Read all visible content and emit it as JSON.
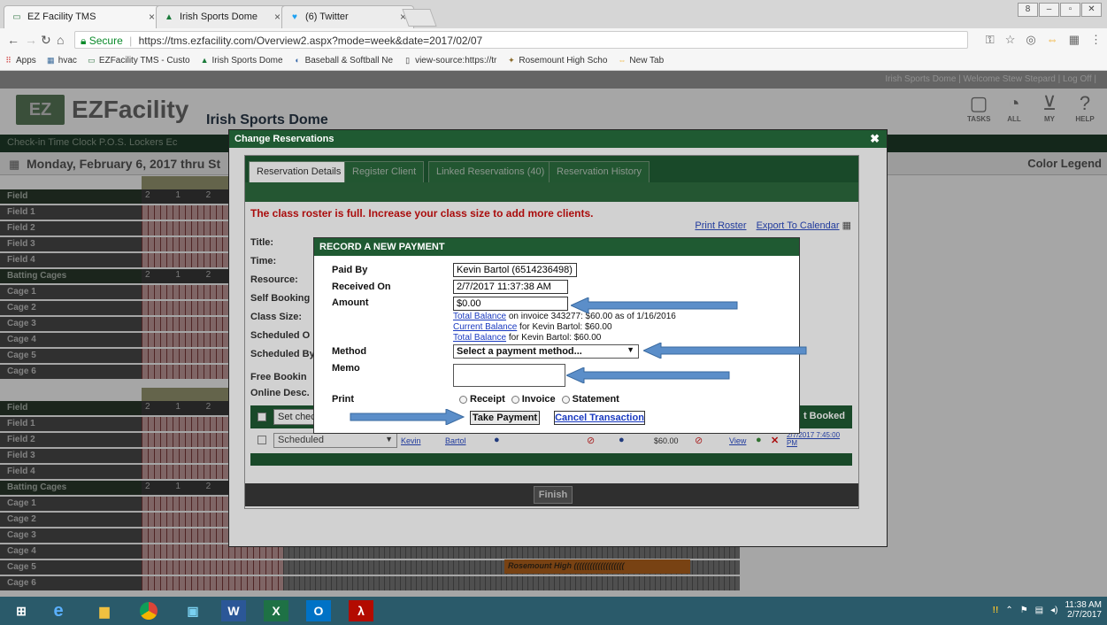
{
  "browser": {
    "tabs": [
      {
        "label": "EZ Facility TMS",
        "icon": "ezfacility-icon"
      },
      {
        "label": "Irish Sports Dome",
        "icon": "irish-icon"
      },
      {
        "label": "(6) Twitter",
        "icon": "twitter-icon"
      }
    ],
    "secure_label": "Secure",
    "url": "https://tms.ezfacility.com/Overview2.aspx?mode=week&date=2017/02/07",
    "bookmarks": [
      {
        "label": "Apps"
      },
      {
        "label": "hvac"
      },
      {
        "label": "EZFacility TMS - Custo"
      },
      {
        "label": "Irish Sports Dome"
      },
      {
        "label": "Baseball & Softball Ne"
      },
      {
        "label": "view-source:https://tr"
      },
      {
        "label": "Rosemount High Scho"
      },
      {
        "label": "New Tab"
      }
    ]
  },
  "page": {
    "top_links": "Irish Sports Dome   |   Welcome Stew Stepard   |   Log Off   |",
    "logo_text": "EZFacility",
    "facility_name": "Irish Sports Dome",
    "top_icons": [
      {
        "label": "TASKS",
        "icon": "clipboard-icon"
      },
      {
        "label": "ALL",
        "icon": "globe-icon"
      },
      {
        "label": "MY",
        "icon": "basket-icon"
      },
      {
        "label": "HELP",
        "icon": "help-icon"
      }
    ],
    "nav": "Check-in  Time Clock  P.O.S.  Lockers  Ec",
    "date_range": "Monday, February 6, 2017 thru St",
    "color_legend": "Color Legend",
    "rows_block1": [
      {
        "label": "Field",
        "header": true,
        "cells": "2 1 2 3"
      },
      {
        "label": "Field 1"
      },
      {
        "label": "Field 2"
      },
      {
        "label": "Field 3"
      },
      {
        "label": "Field 4"
      },
      {
        "label": "Batting Cages",
        "header": true,
        "cells": "2 1 2 3"
      },
      {
        "label": "Cage 1"
      },
      {
        "label": "Cage 2"
      },
      {
        "label": "Cage 3"
      },
      {
        "label": "Cage 4"
      },
      {
        "label": "Cage 5"
      },
      {
        "label": "Cage 6"
      }
    ],
    "rows_block2": [
      {
        "label": "Field",
        "header": true,
        "cells": "2 1 2 3"
      },
      {
        "label": "Field 1"
      },
      {
        "label": "Field 2"
      },
      {
        "label": "Field 3"
      },
      {
        "label": "Field 4"
      },
      {
        "label": "Batting Cages",
        "header": true,
        "cells": "2 1 2 3"
      },
      {
        "label": "Cage 1"
      },
      {
        "label": "Cage 2"
      },
      {
        "label": "Cage 3"
      },
      {
        "label": "Cage 4"
      },
      {
        "label": "Cage 5"
      },
      {
        "label": "Cage 6"
      }
    ],
    "rosemount_bar": "Rosemount High ((((((((((((((((((("
  },
  "change_reservations": {
    "title": "Change Reservations",
    "tabs": [
      "Reservation Details",
      "Register Client",
      "Linked Reservations (40)",
      "Reservation History"
    ],
    "roster_full": "The class roster is full. Increase your class size to add more clients.",
    "print_roster": "Print Roster",
    "export_calendar": "Export To Calendar",
    "fields": [
      "Title:",
      "Time:",
      "Resource:",
      "Self Booking",
      "Class Size:",
      "Scheduled O",
      "Scheduled By",
      "Free Bookin",
      "Online Desc."
    ],
    "set_check": "Set check",
    "last_booked": "t Booked",
    "row": {
      "status": "Scheduled",
      "first": "Kevin",
      "last": "Bartol",
      "amount": "$60.00",
      "view": "View",
      "date": "2/7/2017 7:45:00 PM"
    },
    "finish": "Finish"
  },
  "payment": {
    "title": "RECORD A NEW PAYMENT",
    "paid_by_label": "Paid By",
    "paid_by_value": "Kevin Bartol (6514236498)",
    "received_label": "Received On",
    "received_value": "2/7/2017 11:37:38 AM",
    "amount_label": "Amount",
    "amount_value": "$0.00",
    "balances": [
      {
        "link": "Total Balance",
        "text": " on invoice 343277: $60.00 as of 1/16/2016"
      },
      {
        "link": "Current Balance",
        "text": " for Kevin Bartol: $60.00"
      },
      {
        "link": "Total Balance",
        "text": " for Kevin Bartol: $60.00"
      }
    ],
    "method_label": "Method",
    "method_value": "Select a payment method...",
    "memo_label": "Memo",
    "print_label": "Print",
    "print_options": [
      "Receipt",
      "Invoice",
      "Statement"
    ],
    "take_payment": "Take Payment",
    "cancel_transaction": "Cancel Transaction"
  },
  "taskbar": {
    "apps": [
      "start-icon",
      "ie-icon",
      "explorer-icon",
      "chrome-icon",
      "app-icon",
      "word-icon",
      "excel-icon",
      "outlook-icon",
      "acrobat-icon"
    ],
    "time": "11:38 AM",
    "date": "2/7/2017"
  },
  "colors": {
    "ez_green": "#1f5a32",
    "arrow_blue": "#5b8ec9",
    "error_red": "#d01010",
    "link_blue": "#1a3ac0"
  }
}
